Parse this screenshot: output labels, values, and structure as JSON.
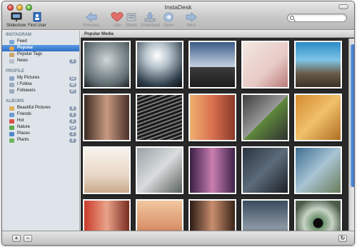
{
  "window": {
    "title": "InstaDesk"
  },
  "toolbar": {
    "slideshow": "Slideshow",
    "find_user": "Find User",
    "previous": "Previous",
    "like": "Like",
    "share": "Share",
    "download": "Download",
    "open": "Open",
    "next": "Next",
    "search_placeholder": ""
  },
  "sidebar": {
    "instagram_header": "INSTAGRAM",
    "feed": "Feed",
    "popular": "Popular",
    "popular_tags": "Popular Tags",
    "news": "News",
    "news_count": "0",
    "profile_header": "PROFILE",
    "my_pictures": "My Pictures",
    "my_pictures_count": "12",
    "i_follow": "I Follow",
    "i_follow_count": "43",
    "followers": "Followers",
    "followers_count": "27",
    "albums_header": "ALBUMS",
    "beautiful_pictures": "Beautiful Pictures",
    "beautiful_pictures_count": "8",
    "friends": "Friends",
    "friends_count": "6",
    "hot": "Hot",
    "hot_count": "6",
    "nature": "Nature",
    "nature_count": "14",
    "places": "Places",
    "places_count": "3",
    "plants": "Plants",
    "plants_count": "6"
  },
  "content": {
    "header": "Popular Media"
  },
  "bottombar": {
    "add": "+",
    "remove": "−",
    "refresh": "↻"
  },
  "colors": {
    "selection": "#3a7bd5",
    "sidebar_bg": "#dfe4ea",
    "grid_bg": "#2a2a2a"
  }
}
